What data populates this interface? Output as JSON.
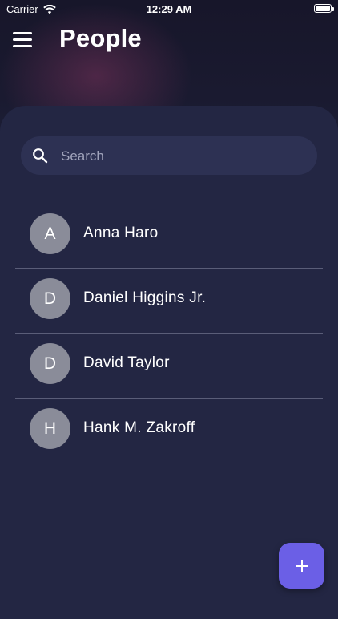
{
  "status_bar": {
    "carrier": "Carrier",
    "time": "12:29 AM"
  },
  "header": {
    "title": "People",
    "menu_icon": "hamburger-menu-icon"
  },
  "search": {
    "placeholder": "Search",
    "value": "",
    "icon": "search-icon"
  },
  "people": [
    {
      "initial": "A",
      "name": "Anna Haro"
    },
    {
      "initial": "D",
      "name": "Daniel Higgins Jr."
    },
    {
      "initial": "D",
      "name": "David Taylor"
    },
    {
      "initial": "H",
      "name": "Hank M. Zakroff"
    }
  ],
  "fab": {
    "icon": "plus-icon"
  },
  "colors": {
    "accent": "#6b5fe6",
    "background": "#1d1f38",
    "panel": "#232643",
    "avatar": "#8a8c99"
  }
}
